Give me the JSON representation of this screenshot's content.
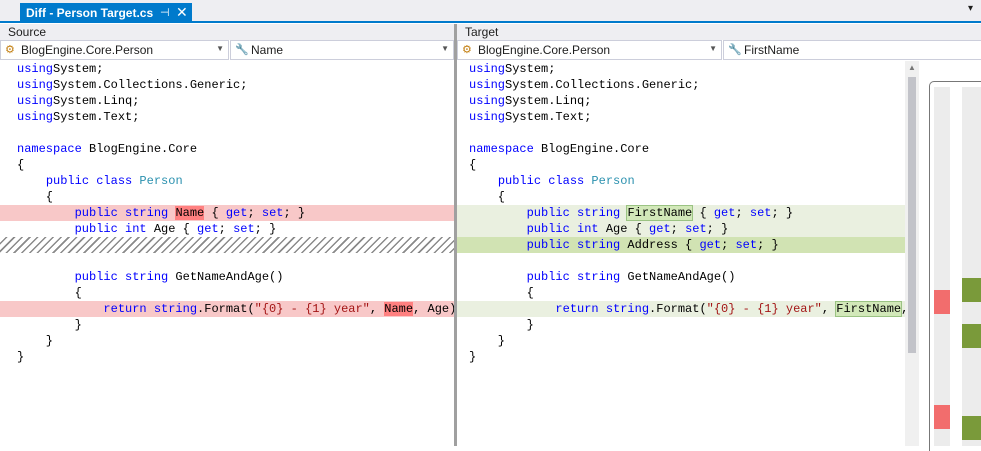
{
  "tab": {
    "title": "Diff - Person Target.cs",
    "pin_glyph": "⊣",
    "close_glyph": "✕"
  },
  "source": {
    "label": "Source",
    "namespace_combo": "BlogEngine.Core.Person",
    "member_combo": "Name",
    "lines": [
      [
        [
          "kw",
          "using"
        ],
        [
          "",
          "System;"
        ]
      ],
      [
        [
          "kw",
          "using"
        ],
        [
          "",
          "System.Collections.Generic;"
        ]
      ],
      [
        [
          "kw",
          "using"
        ],
        [
          "",
          "System.Linq;"
        ]
      ],
      [
        [
          "kw",
          "using"
        ],
        [
          "",
          "System.Text;"
        ]
      ],
      [],
      [
        [
          "kw",
          "namespace"
        ],
        [
          "",
          " BlogEngine.Core"
        ]
      ],
      [
        [
          "",
          "{"
        ]
      ],
      [
        [
          "",
          "    "
        ],
        [
          "kw",
          "public class"
        ],
        [
          "ty",
          " Person"
        ]
      ],
      [
        [
          "",
          "    {"
        ]
      ],
      [
        [
          "",
          "        "
        ],
        [
          "kw",
          "public string"
        ],
        [
          "",
          " "
        ],
        [
          "hr",
          "Name"
        ],
        [
          "",
          " { "
        ],
        [
          "kw",
          "get"
        ],
        [
          "",
          "; "
        ],
        [
          "kw",
          "set"
        ],
        [
          "",
          "; }"
        ]
      ],
      [
        [
          "",
          "        "
        ],
        [
          "kw",
          "public int"
        ],
        [
          "",
          " Age { "
        ],
        [
          "kw",
          "get"
        ],
        [
          "",
          "; "
        ],
        [
          "kw",
          "set"
        ],
        [
          "",
          "; }"
        ]
      ],
      [],
      [],
      [
        [
          "",
          "        "
        ],
        [
          "kw",
          "public string"
        ],
        [
          "",
          " GetNameAndAge()"
        ]
      ],
      [
        [
          "",
          "        {"
        ]
      ],
      [
        [
          "",
          "            "
        ],
        [
          "kw",
          "return string"
        ],
        [
          "",
          ".Format("
        ],
        [
          "st",
          "\"{0} - {1} year\""
        ],
        [
          "",
          ", "
        ],
        [
          "hr",
          "Name"
        ],
        [
          "",
          ", Age);"
        ]
      ],
      [
        [
          "",
          "        }"
        ]
      ],
      [
        [
          "",
          "    }"
        ]
      ],
      [
        [
          "",
          "}"
        ]
      ]
    ]
  },
  "target": {
    "label": "Target",
    "namespace_combo": "BlogEngine.Core.Person",
    "member_combo": "FirstName",
    "lines": [
      [
        [
          "kw",
          "using"
        ],
        [
          "",
          "System;"
        ]
      ],
      [
        [
          "kw",
          "using"
        ],
        [
          "",
          "System.Collections.Generic;"
        ]
      ],
      [
        [
          "kw",
          "using"
        ],
        [
          "",
          "System.Linq;"
        ]
      ],
      [
        [
          "kw",
          "using"
        ],
        [
          "",
          "System.Text;"
        ]
      ],
      [],
      [
        [
          "kw",
          "namespace"
        ],
        [
          "",
          " BlogEngine.Core"
        ]
      ],
      [
        [
          "",
          "{"
        ]
      ],
      [
        [
          "",
          "    "
        ],
        [
          "kw",
          "public class"
        ],
        [
          "ty",
          " Person"
        ]
      ],
      [
        [
          "",
          "    {"
        ]
      ],
      [
        [
          "",
          "        "
        ],
        [
          "kw",
          "public string"
        ],
        [
          "",
          " "
        ],
        [
          "hg",
          "FirstName"
        ],
        [
          "",
          " { "
        ],
        [
          "kw",
          "get"
        ],
        [
          "",
          "; "
        ],
        [
          "kw",
          "set"
        ],
        [
          "",
          "; }"
        ]
      ],
      [
        [
          "",
          "        "
        ],
        [
          "kw",
          "public int"
        ],
        [
          "",
          " Age { "
        ],
        [
          "kw",
          "get"
        ],
        [
          "",
          "; "
        ],
        [
          "kw",
          "set"
        ],
        [
          "",
          "; }"
        ]
      ],
      [
        [
          "",
          "        "
        ],
        [
          "kw",
          "public string"
        ],
        [
          "",
          " Address { "
        ],
        [
          "kw",
          "get"
        ],
        [
          "",
          "; "
        ],
        [
          "kw",
          "set"
        ],
        [
          "",
          "; }"
        ]
      ],
      [],
      [
        [
          "",
          "        "
        ],
        [
          "kw",
          "public string"
        ],
        [
          "",
          " GetNameAndAge()"
        ]
      ],
      [
        [
          "",
          "        {"
        ]
      ],
      [
        [
          "",
          "            "
        ],
        [
          "kw",
          "return string"
        ],
        [
          "",
          ".Format("
        ],
        [
          "st",
          "\"{0} - {1} year\""
        ],
        [
          "",
          ", "
        ],
        [
          "hg",
          "FirstName"
        ],
        [
          "",
          ", A"
        ]
      ],
      [
        [
          "",
          "        }"
        ]
      ],
      [
        [
          "",
          "    }"
        ]
      ],
      [
        [
          "",
          "}"
        ]
      ]
    ]
  },
  "colors": {
    "accent": "#007acc",
    "removed": "#f8c8c8",
    "removed_word": "#ff8080",
    "added_light": "#eaf0e0",
    "added_dark": "#d1e3b3",
    "overview_red": "#f26d6d",
    "overview_green": "#7a9a3a"
  }
}
